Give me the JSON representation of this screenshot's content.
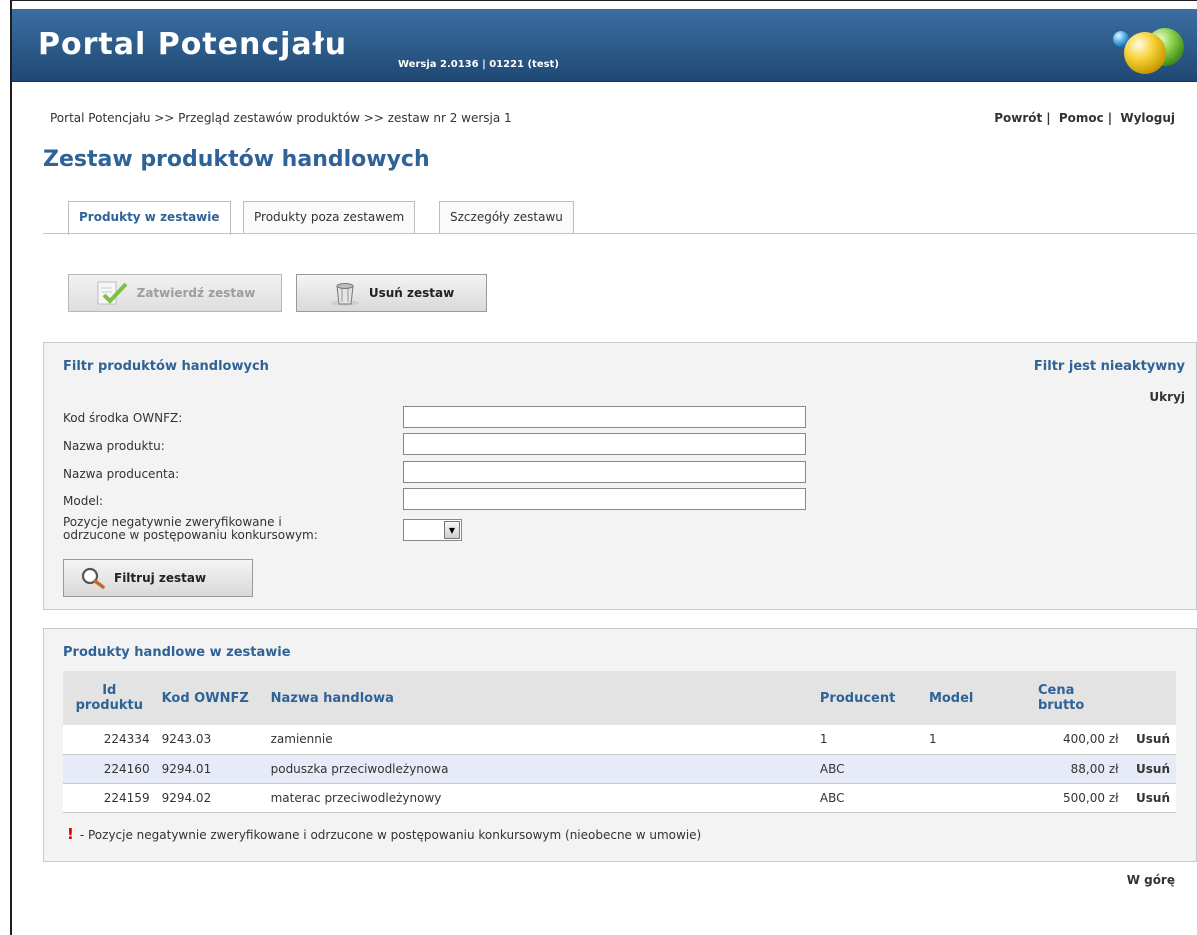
{
  "header": {
    "app_title": "Portal Potencjału",
    "version": "Wersja 2.0136 | 01221 (test)"
  },
  "breadcrumb": "Portal Potencjału >> Przegląd zestawów produktów >> zestaw nr 2 wersja 1",
  "top_links": {
    "back": "Powrót",
    "help": "Pomoc",
    "logout": "Wyloguj"
  },
  "page_title": "Zestaw produktów handlowych",
  "tabs": [
    {
      "label": "Produkty w zestawie",
      "active": true
    },
    {
      "label": "Produkty poza zestawem",
      "active": false
    },
    {
      "label": "Szczegóły zestawu",
      "active": false
    }
  ],
  "actions": {
    "approve": "Zatwierdź zestaw",
    "delete": "Usuń zestaw"
  },
  "filter": {
    "title": "Filtr produktów handlowych",
    "status": "Filtr jest nieaktywny",
    "hide": "Ukryj",
    "fields": {
      "code_label": "Kod środka OWNFZ:",
      "code_value": "",
      "product_label": "Nazwa produktu:",
      "product_value": "",
      "producer_label": "Nazwa producenta:",
      "producer_value": "",
      "model_label": "Model:",
      "model_value": "",
      "negative_label_1": "Pozycje negatywnie zweryfikowane i",
      "negative_label_2": "odrzucone w postępowaniu konkursowym:",
      "negative_value": ""
    },
    "submit": "Filtruj zestaw"
  },
  "products": {
    "title": "Produkty handlowe w zestawie",
    "columns": {
      "id_1": "Id",
      "id_2": "produktu",
      "code": "Kod OWNFZ",
      "name": "Nazwa handlowa",
      "producer": "Producent",
      "model": "Model",
      "price_1": "Cena",
      "price_2": "brutto"
    },
    "rows": [
      {
        "id": "224334",
        "code": "9243.03",
        "name": "zamiennie",
        "producer": "1",
        "model": "1",
        "price": "400,00 zł",
        "action": "Usuń"
      },
      {
        "id": "224160",
        "code": "9294.01",
        "name": "poduszka przeciwodleżynowa",
        "producer": "ABC",
        "model": "",
        "price": "88,00 zł",
        "action": "Usuń"
      },
      {
        "id": "224159",
        "code": "9294.02",
        "name": "materac przeciwodleżynowy",
        "producer": "ABC",
        "model": "",
        "price": "500,00 zł",
        "action": "Usuń"
      }
    ],
    "legend_mark": "!",
    "legend_text": "- Pozycje negatywnie zweryfikowane i odrzucone w postępowaniu konkursowym (nieobecne w umowie)"
  },
  "footer": {
    "top_link": "W górę"
  },
  "colors": {
    "header_blue": "#2c5a89",
    "title_blue": "#2f6296",
    "alt_row": "#e6ebf7",
    "legend_red": "#d00000"
  }
}
